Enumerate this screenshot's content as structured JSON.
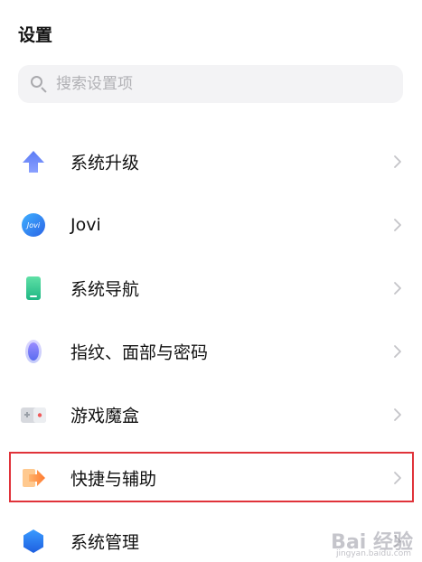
{
  "header": {
    "title": "设置"
  },
  "search": {
    "placeholder": "搜索设置项",
    "value": ""
  },
  "items": [
    {
      "label": "系统升级",
      "icon": "arrow-up-icon"
    },
    {
      "label": "Jovi",
      "icon": "jovi-icon",
      "icon_text": "Jovi"
    },
    {
      "label": "系统导航",
      "icon": "phone-navigation-icon"
    },
    {
      "label": "指纹、面部与密码",
      "icon": "fingerprint-icon"
    },
    {
      "label": "游戏魔盒",
      "icon": "game-box-icon"
    },
    {
      "label": "快捷与辅助",
      "icon": "shortcut-arrow-icon",
      "highlighted": true
    },
    {
      "label": "系统管理",
      "icon": "hexagon-icon"
    }
  ],
  "watermark": {
    "text": "Bai 经验",
    "sub": "jingyan.baidu.com"
  },
  "colors": {
    "highlight_border": "#e0333a",
    "search_bg": "#f3f3f5"
  }
}
